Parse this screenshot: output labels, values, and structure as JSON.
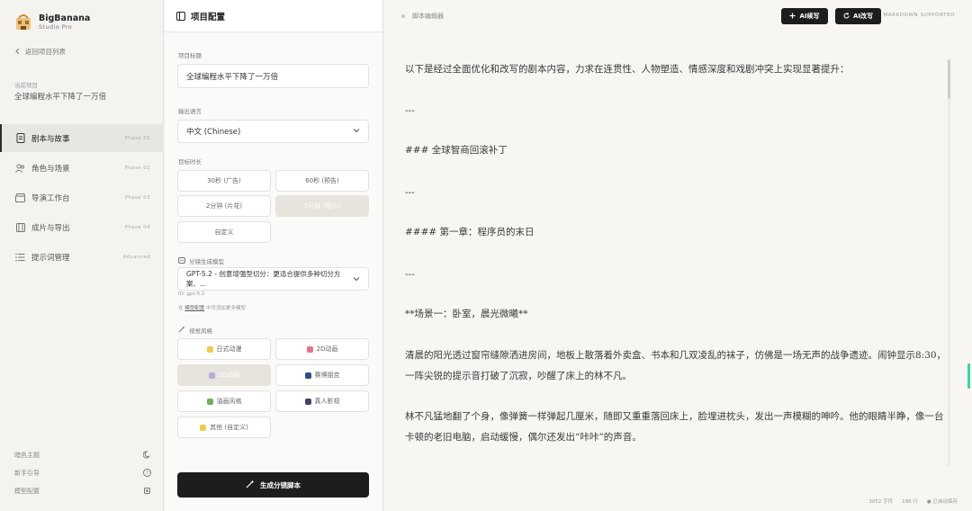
{
  "brand": {
    "name": "BigBanana",
    "sub": "Studio Pro"
  },
  "back_label": "返回项目列表",
  "current_project": {
    "label": "当前项目",
    "name": "全球编程水平下降了一万倍"
  },
  "nav": [
    {
      "label": "剧本与故事",
      "phase": "Phase 01",
      "icon": "document-icon"
    },
    {
      "label": "角色与场景",
      "phase": "Phase 02",
      "icon": "users-icon"
    },
    {
      "label": "导演工作台",
      "phase": "Phase 03",
      "icon": "clapperboard-icon"
    },
    {
      "label": "成片与导出",
      "phase": "Phase 04",
      "icon": "film-icon"
    },
    {
      "label": "提示词管理",
      "phase": "Advanced",
      "icon": "list-icon"
    }
  ],
  "bottom_options": [
    {
      "label": "暗色主题",
      "icon": "moon-icon"
    },
    {
      "label": "新手引导",
      "icon": "help-icon"
    },
    {
      "label": "模型配置",
      "icon": "chip-icon"
    }
  ],
  "config": {
    "header": "项目配置",
    "title_label": "项目标题",
    "title_value": "全球编程水平下降了一万倍",
    "language_label": "输出语言",
    "language_value": "中文 (Chinese)",
    "duration_label": "目标时长",
    "durations": [
      "30秒 (广告)",
      "60秒 (预告)",
      "2分钟 (片花)",
      "5分钟 (短片)",
      "自定义"
    ],
    "model_label": "分镜生成模型",
    "model_value": "GPT-5.2 - 创意增强型切分：更适合提供多种切分方案、...",
    "model_id": "ID: gpt-5.2",
    "model_note_pre": "在",
    "model_note_link": "模型配置",
    "model_note_post": "中可添加更多模型",
    "style_label": "视觉风格",
    "styles": [
      "日式动漫",
      "2D动画",
      "3D动画",
      "赛博朋克",
      "油画风格",
      "真人影视",
      "其他 (自定义)"
    ],
    "generate_label": "生成分镜脚本"
  },
  "editor": {
    "title": "脚本编辑器",
    "ai_continue": "AI续写",
    "ai_rewrite": "AI改写",
    "md_note": "MARKDOWN SUPPORTED",
    "lines": [
      "以下是经过全面优化和改写的剧本内容，力求在连贯性、人物塑造、情感深度和戏剧冲突上实现显著提升：",
      "---",
      "### 全球智商回滚补丁",
      "---",
      "#### 第一章：程序员的末日",
      "---",
      "**场景一：卧室，晨光微曦**",
      "清晨的阳光透过窗帘缝隙洒进房间，地板上散落着外卖盒、书本和几双凌乱的袜子，仿佛是一场无声的战争遗迹。闹钟显示8:30，一阵尖锐的提示音打破了沉寂，吵醒了床上的林不凡。",
      "林不凡猛地翻了个身，像弹簧一样弹起几厘米，随即又重重落回床上，脸埋进枕头，发出一声模糊的呻吟。他的眼睛半睁，像一台卡顿的老旧电脑，启动缓慢，偶尔还发出“咔咔”的声音。"
    ],
    "footer": {
      "chars": "3052 字符",
      "lines": "196 行",
      "autosave": "已自动保存"
    }
  },
  "colors": {
    "accent": "#1d1d1d",
    "scroll_accent": "#3fd1a8",
    "selected": "#e7e4de"
  }
}
